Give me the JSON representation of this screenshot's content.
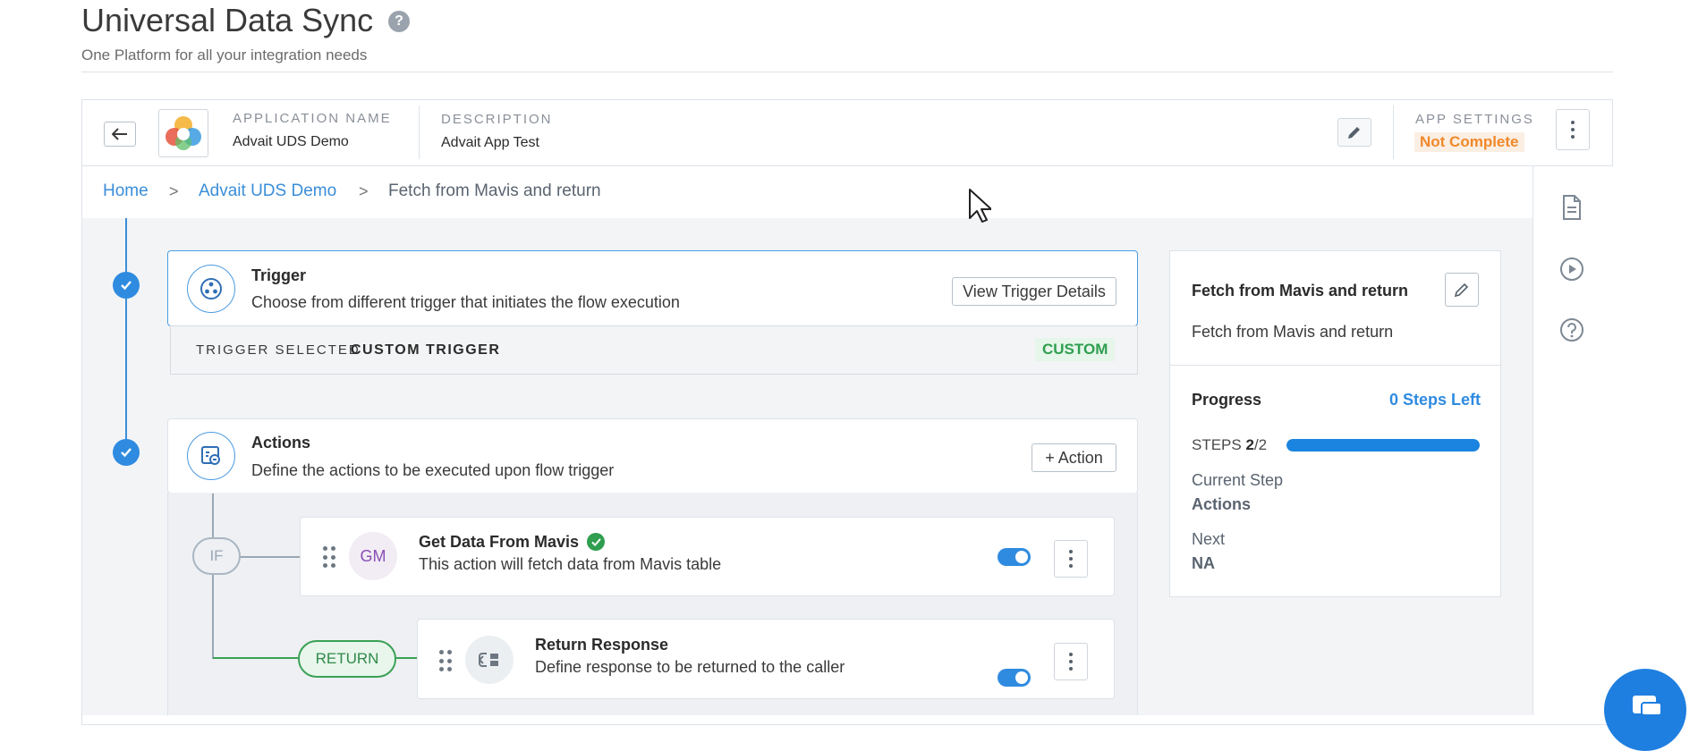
{
  "header": {
    "title": "Universal Data Sync",
    "help_glyph": "?",
    "subtitle": "One Platform for all your integration needs"
  },
  "app": {
    "name_label": "APPLICATION NAME",
    "name_value": "Advait UDS Demo",
    "description_label": "DESCRIPTION",
    "description_value": "Advait App Test",
    "settings_label": "APP SETTINGS",
    "settings_status": "Not Complete"
  },
  "breadcrumb": {
    "home": "Home",
    "app": "Advait UDS Demo",
    "current": "Fetch from Mavis and return",
    "separator": ">"
  },
  "trigger": {
    "title": "Trigger",
    "description": "Choose from different trigger that initiates the flow execution",
    "button": "View Trigger Details",
    "selected_label": "TRIGGER SELECTED",
    "selected_value": "CUSTOM TRIGGER",
    "type_badge": "CUSTOM"
  },
  "actions": {
    "title": "Actions",
    "description": "Define the actions to be executed upon flow trigger",
    "add_button": "+ Action",
    "if_label": "IF",
    "return_label": "RETURN",
    "items": [
      {
        "initials": "GM",
        "title": "Get Data From Mavis",
        "description": "This action will fetch data from Mavis table",
        "enabled": true,
        "verified": true
      },
      {
        "icon": "return-response-icon",
        "title": "Return Response",
        "description": "Define response to be returned to the caller",
        "enabled": true
      }
    ]
  },
  "summary": {
    "title": "Fetch from Mavis and return",
    "description": "Fetch from Mavis and return",
    "progress_label": "Progress",
    "steps_left": "0 Steps Left",
    "steps_label": "STEPS",
    "steps_done": "2",
    "steps_total": "/2",
    "progress_fraction": 1.0,
    "current_step_label": "Current Step",
    "current_step_value": "Actions",
    "next_label": "Next",
    "next_value": "NA"
  },
  "colors": {
    "accent": "#2f8be0",
    "success": "#2f9e4f",
    "warning": "#f0892b"
  }
}
